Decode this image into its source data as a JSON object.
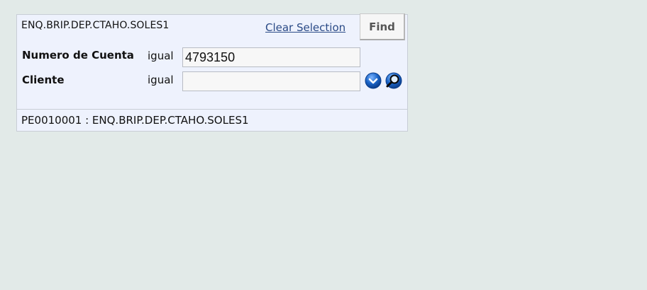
{
  "enquiry": {
    "title": "ENQ.BRIP.DEP.CTAHO.SOLES1",
    "clear_selection_label": "Clear Selection",
    "find_label": "Find"
  },
  "criteria": [
    {
      "label": "Numero de Cuenta",
      "operator": "igual",
      "value": "4793150",
      "placeholder": ""
    },
    {
      "label": "Cliente",
      "operator": "igual",
      "value": "",
      "placeholder": ""
    }
  ],
  "icons": {
    "dropdown": "chevron-down-icon",
    "lookup": "magnifier-icon"
  },
  "colors": {
    "page_background": "#e2eae8",
    "panel_background": "#eef2fd",
    "link": "#2a4a86",
    "icon_blue": "#1a64c8"
  },
  "footer": {
    "text": "PE0010001 : ENQ.BRIP.DEP.CTAHO.SOLES1"
  }
}
